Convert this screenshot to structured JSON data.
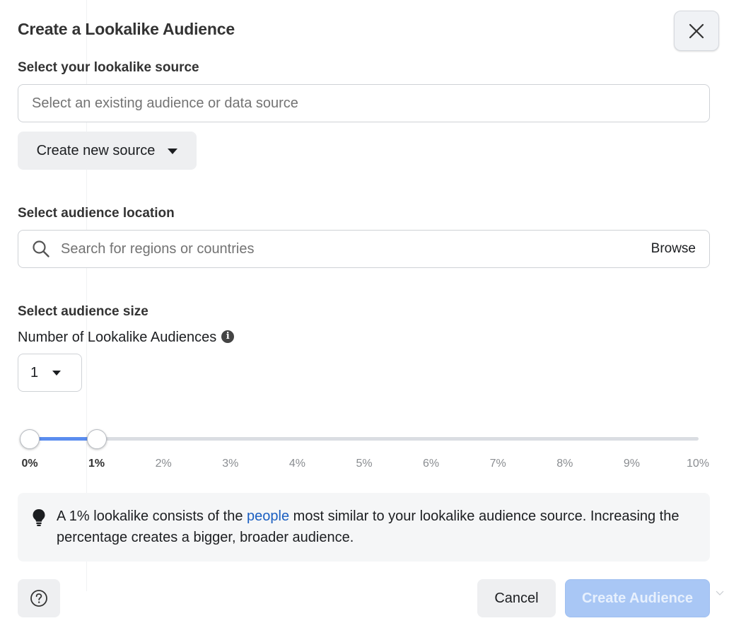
{
  "dialog": {
    "title": "Create a Lookalike Audience",
    "close_icon": "close-icon"
  },
  "source": {
    "label": "Select your lookalike source",
    "placeholder": "Select an existing audience or data source",
    "create_button": "Create new source",
    "create_caret_icon": "caret-down-icon"
  },
  "location": {
    "label": "Select audience location",
    "search_icon": "search-icon",
    "placeholder": "Search for regions or countries",
    "browse": "Browse"
  },
  "size": {
    "label": "Select audience size",
    "number_label": "Number of Lookalike Audiences",
    "info_icon": "info-icon",
    "number_value": "1",
    "slider": {
      "min_value": 0,
      "max_value": 1,
      "range_max": 10,
      "ticks": [
        "0%",
        "1%",
        "2%",
        "3%",
        "4%",
        "5%",
        "6%",
        "7%",
        "8%",
        "9%",
        "10%"
      ]
    }
  },
  "tip": {
    "icon": "lightbulb-icon",
    "text_before": "A 1% lookalike consists of the ",
    "link": "people",
    "text_after": " most similar to your lookalike audience source. Increasing the percentage creates a bigger, broader audience."
  },
  "footer": {
    "help_icon": "help-icon",
    "cancel": "Cancel",
    "create": "Create Audience"
  },
  "colors": {
    "accent": "#5b8def",
    "link": "#1b5fc1",
    "disabled_primary": "#a9c7f5"
  }
}
